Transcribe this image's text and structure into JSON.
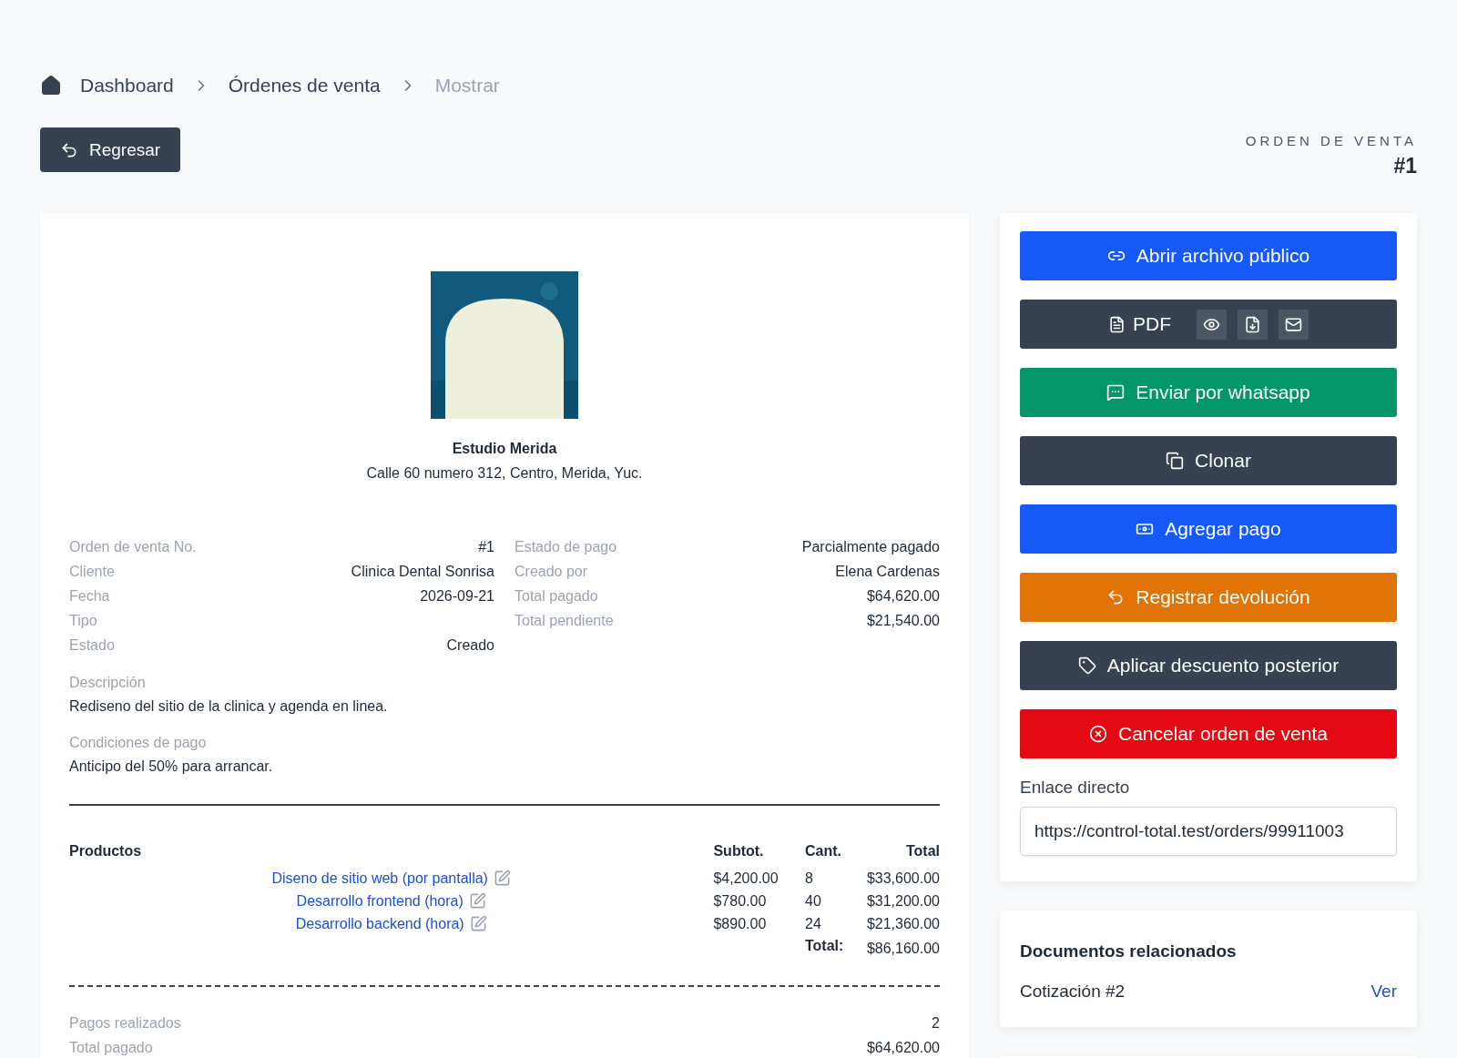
{
  "breadcrumb": [
    {
      "label": "Dashboard",
      "current": false
    },
    {
      "label": "Órdenes de venta",
      "current": false
    },
    {
      "label": "Mostrar",
      "current": true
    }
  ],
  "back_button": "Regresar",
  "header": {
    "caption": "ORDEN DE VENTA",
    "number": "#1"
  },
  "company": {
    "name": "Estudio Merida",
    "address": "Calle 60 numero 312, Centro, Merida, Yuc."
  },
  "details_left": [
    {
      "label": "Orden de venta No.",
      "value": "#1"
    },
    {
      "label": "Cliente",
      "value": "Clinica Dental Sonrisa"
    },
    {
      "label": "Fecha",
      "value": "2026-09-21"
    },
    {
      "label": "Tipo"
    },
    {
      "label": "Estado",
      "value": "Creado"
    }
  ],
  "details_right": [
    {
      "label": "Estado de pago",
      "value": "Parcialmente pagado"
    },
    {
      "label": "Creado por",
      "value": "Elena Cardenas"
    },
    {
      "label": "Total pagado",
      "value": "$64,620.00"
    },
    {
      "label": "Total pendiente",
      "value": "$21,540.00"
    }
  ],
  "notes": [
    {
      "label": "Descripción",
      "text": "Rediseno del sitio de la clinica y agenda en linea."
    },
    {
      "label": "Condiciones de pago",
      "text": "Anticipo del 50% para arrancar."
    }
  ],
  "products": {
    "columns": [
      "Productos",
      "Subtot.",
      "Cant.",
      "Total"
    ],
    "rows": [
      {
        "name": "Diseno de sitio web (por pantalla)",
        "subtotal": "$4,200.00",
        "qty": "8",
        "total": "$33,600.00"
      },
      {
        "name": "Desarrollo frontend (hora)",
        "subtotal": "$780.00",
        "qty": "40",
        "total": "$31,200.00"
      },
      {
        "name": "Desarrollo backend (hora)",
        "subtotal": "$890.00",
        "qty": "24",
        "total": "$21,360.00"
      }
    ],
    "total_label": "Total:",
    "total": "$86,160.00"
  },
  "payments": [
    {
      "label": "Pagos realizados",
      "value": "2"
    },
    {
      "label": "Total pagado",
      "value": "$64,620.00"
    }
  ],
  "actions": [
    {
      "label": "Abrir archivo público",
      "kind": "button"
    },
    {
      "label": "PDF",
      "kind": "pdf"
    },
    {
      "label": "Enviar por whatsapp",
      "kind": "button"
    },
    {
      "label": "Clonar",
      "kind": "button"
    },
    {
      "label": "Agregar pago",
      "kind": "button"
    },
    {
      "label": "Registrar devolución",
      "kind": "button"
    },
    {
      "label": "Aplicar descuento posterior",
      "kind": "button"
    },
    {
      "label": "Cancelar orden de venta",
      "kind": "button"
    }
  ],
  "direct_link": {
    "label": "Enlace directo",
    "value": "https://control-total.test/orders/99911003"
  },
  "related": {
    "title": "Documentos relacionados",
    "items": [
      {
        "label": "Cotización #2",
        "link": "Ver"
      }
    ]
  }
}
